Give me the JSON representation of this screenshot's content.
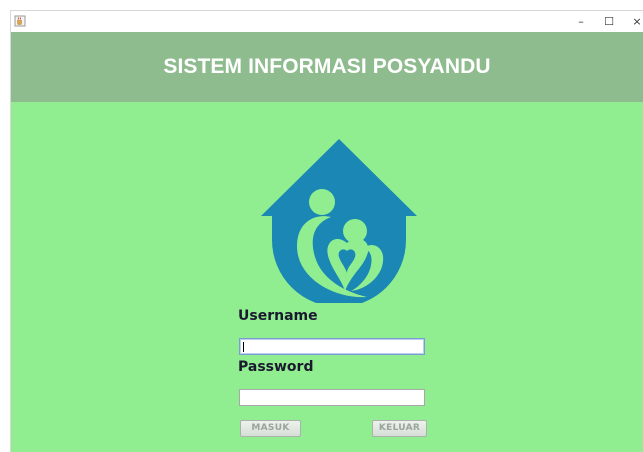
{
  "window": {
    "icon": "java-cup-icon",
    "controls": {
      "minimize": "–",
      "maximize": "☐",
      "close": "×"
    }
  },
  "header": {
    "title": "SISTEM INFORMASI POSYANDU"
  },
  "logo": {
    "icon": "house-family-logo",
    "color": "#1a87b5"
  },
  "form": {
    "username_label": "Username",
    "username_value": "",
    "password_label": "Password",
    "password_value": "",
    "login_button": "MASUK",
    "exit_button": "KELUAR"
  },
  "colors": {
    "header_bg": "#8fbc8f",
    "content_bg": "#90ee90",
    "title_text": "#ffffff",
    "label_text": "#1a1a2e"
  }
}
